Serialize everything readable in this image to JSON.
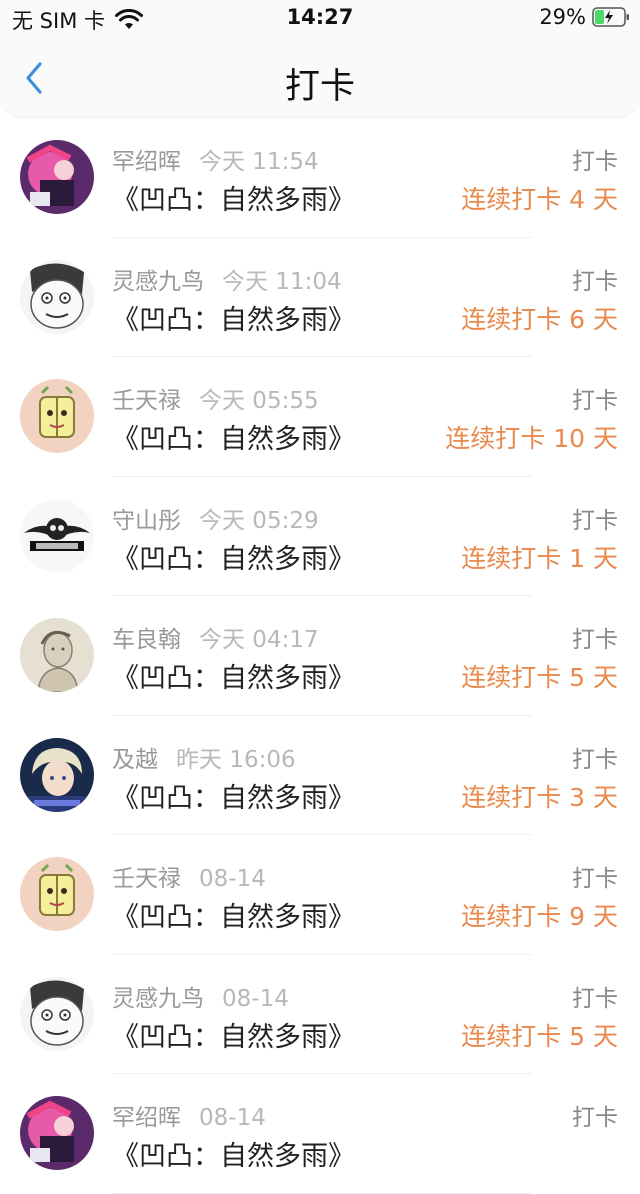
{
  "status_bar": {
    "carrier": "无 SIM 卡",
    "time": "14:27",
    "battery": "29%"
  },
  "nav": {
    "title": "打卡",
    "back_icon": "chevron-left-icon"
  },
  "colors": {
    "accent_blue": "#3b8fdc",
    "streak_orange": "#e8894e",
    "battery_green": "#4cd964"
  },
  "checkins": [
    {
      "name": "罕绍晖",
      "time": "今天 11:54",
      "book": "《凹凸：自然多雨》",
      "action": "打卡",
      "streak": "连续打卡 4 天",
      "avatar": "anime-avatar-pink"
    },
    {
      "name": "灵感九鸟",
      "time": "今天 11:04",
      "book": "《凹凸：自然多雨》",
      "action": "打卡",
      "streak": "连续打卡 6 天",
      "avatar": "meme-face-avatar"
    },
    {
      "name": "壬天禄",
      "time": "今天 05:55",
      "book": "《凹凸：自然多雨》",
      "action": "打卡",
      "streak": "连续打卡 10 天",
      "avatar": "cartoon-avatar-peach"
    },
    {
      "name": "守山彤",
      "time": "今天 05:29",
      "book": "《凹凸：自然多雨》",
      "action": "打卡",
      "streak": "连续打卡 1 天",
      "avatar": "skull-logo-avatar"
    },
    {
      "name": "车良翰",
      "time": "今天 04:17",
      "book": "《凹凸：自然多雨》",
      "action": "打卡",
      "streak": "连续打卡 5 天",
      "avatar": "sketch-portrait-avatar"
    },
    {
      "name": "及越",
      "time": "昨天 16:06",
      "book": "《凹凸：自然多雨》",
      "action": "打卡",
      "streak": "连续打卡 3 天",
      "avatar": "anime-avatar-blonde"
    },
    {
      "name": "壬天禄",
      "time": "08-14",
      "book": "《凹凸：自然多雨》",
      "action": "打卡",
      "streak": "连续打卡 9 天",
      "avatar": "cartoon-avatar-peach"
    },
    {
      "name": "灵感九鸟",
      "time": "08-14",
      "book": "《凹凸：自然多雨》",
      "action": "打卡",
      "streak": "连续打卡 5 天",
      "avatar": "meme-face-avatar"
    },
    {
      "name": "罕绍晖",
      "time": "08-14",
      "book": "《凹凸：自然多雨》",
      "action": "打卡",
      "streak": "",
      "avatar": "anime-avatar-pink"
    }
  ]
}
